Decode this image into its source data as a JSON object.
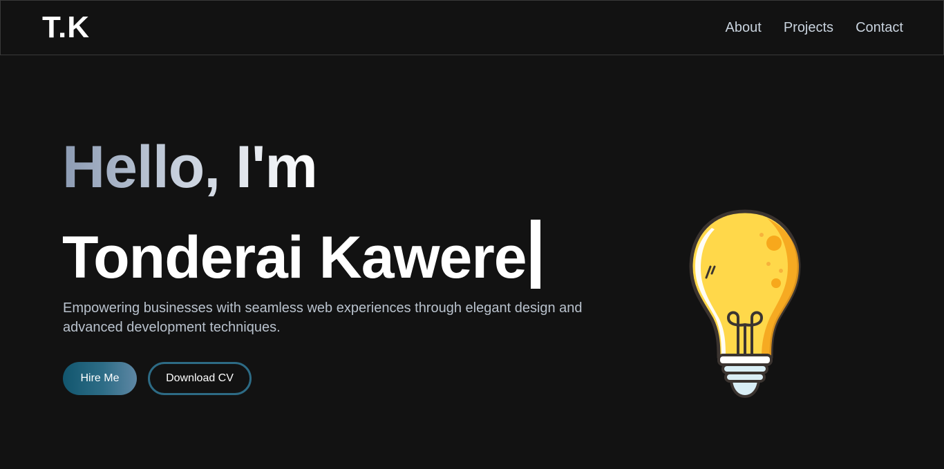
{
  "header": {
    "logo": "T.K",
    "nav": [
      {
        "label": "About"
      },
      {
        "label": "Projects"
      },
      {
        "label": "Contact"
      }
    ]
  },
  "hero": {
    "greeting": "Hello, I'm",
    "name": "Tonderai Kawere",
    "tagline": "Empowering businesses with seamless web experiences through elegant design and advanced development techniques.",
    "buttons": {
      "hire": "Hire Me",
      "cv": "Download CV"
    },
    "illustration": "lightbulb-icon"
  },
  "colors": {
    "background": "#121212",
    "accent_teal": "#12566e",
    "accent_slate": "#5e87a4",
    "bulb_yellow": "#ffd84a",
    "nav_text": "#c9d3de"
  }
}
